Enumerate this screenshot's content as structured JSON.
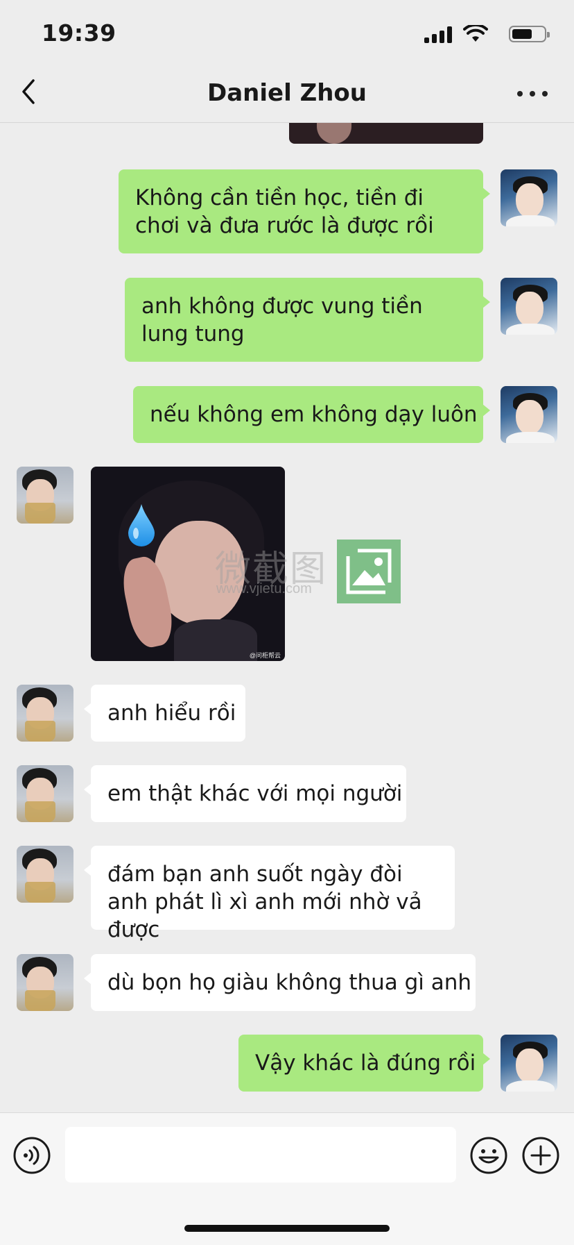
{
  "status_bar": {
    "time": "19:39",
    "icons": [
      "signal-icon",
      "wifi-icon",
      "battery-icon"
    ]
  },
  "nav": {
    "title": "Daniel Zhou",
    "back_icon": "chevron-left-icon",
    "more_icon": "more-icon"
  },
  "messages": [
    {
      "sender": "me",
      "type": "image"
    },
    {
      "sender": "me",
      "type": "text",
      "text": "Không cần tiền học, tiền đi chơi và đưa rước là được rồi"
    },
    {
      "sender": "me",
      "type": "text",
      "text": "anh không được vung tiền lung tung"
    },
    {
      "sender": "me",
      "type": "text",
      "text": "nếu không em không dạy luôn"
    },
    {
      "sender": "other",
      "type": "image",
      "caption": "@问柜帮云"
    },
    {
      "sender": "other",
      "type": "text",
      "text": "anh hiểu rồi"
    },
    {
      "sender": "other",
      "type": "text",
      "text": "em thật khác với mọi người"
    },
    {
      "sender": "other",
      "type": "text",
      "text": "đám bạn anh suốt ngày đòi anh phát lì xì anh mới nhờ vả được"
    },
    {
      "sender": "other",
      "type": "text",
      "text": "dù bọn họ giàu không thua gì anh"
    },
    {
      "sender": "me",
      "type": "text",
      "text": "Vậy khác là đúng rồi"
    }
  ],
  "watermark": {
    "title": "微截图",
    "url": "www.vjietu.com"
  },
  "input_bar": {
    "placeholder": "",
    "voice_icon": "voice-icon",
    "emoji_icon": "emoji-icon",
    "plus_icon": "plus-icon"
  },
  "colors": {
    "background": "#EDEDED",
    "bubble_me": "#A9E980",
    "bubble_other": "#FFFFFF"
  }
}
